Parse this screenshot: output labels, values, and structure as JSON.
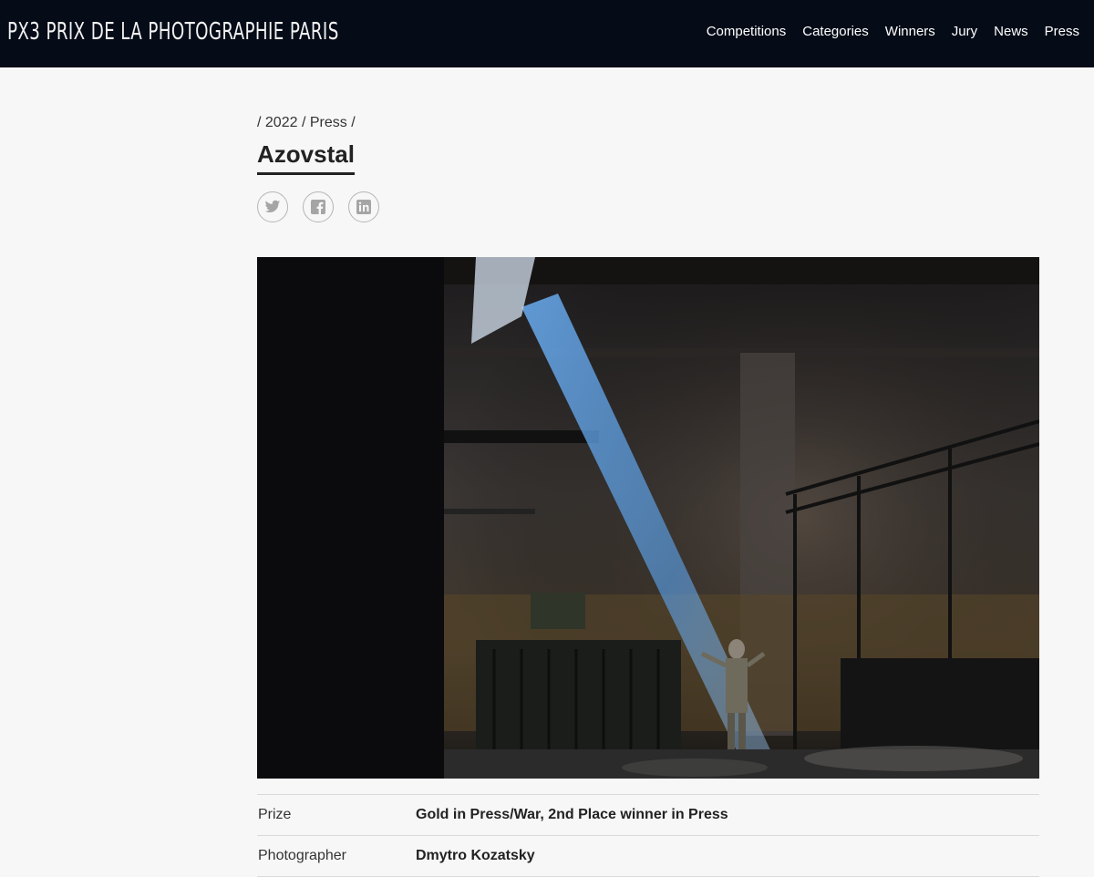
{
  "header": {
    "logo": "PX3 PRIX DE LA PHOTOGRAPHIE PARIS",
    "nav": [
      "Competitions",
      "Categories",
      "Winners",
      "Jury",
      "News",
      "Press"
    ]
  },
  "breadcrumb": [
    "/ 2022",
    "/ Press",
    "/"
  ],
  "title": "Azovstal",
  "share": [
    "twitter-icon",
    "facebook-icon",
    "linkedin-icon"
  ],
  "details": [
    {
      "label": "Prize",
      "value": "Gold in Press/War, 2nd Place winner in Press"
    },
    {
      "label": "Photographer",
      "value": "Dmytro Kozatsky"
    }
  ]
}
